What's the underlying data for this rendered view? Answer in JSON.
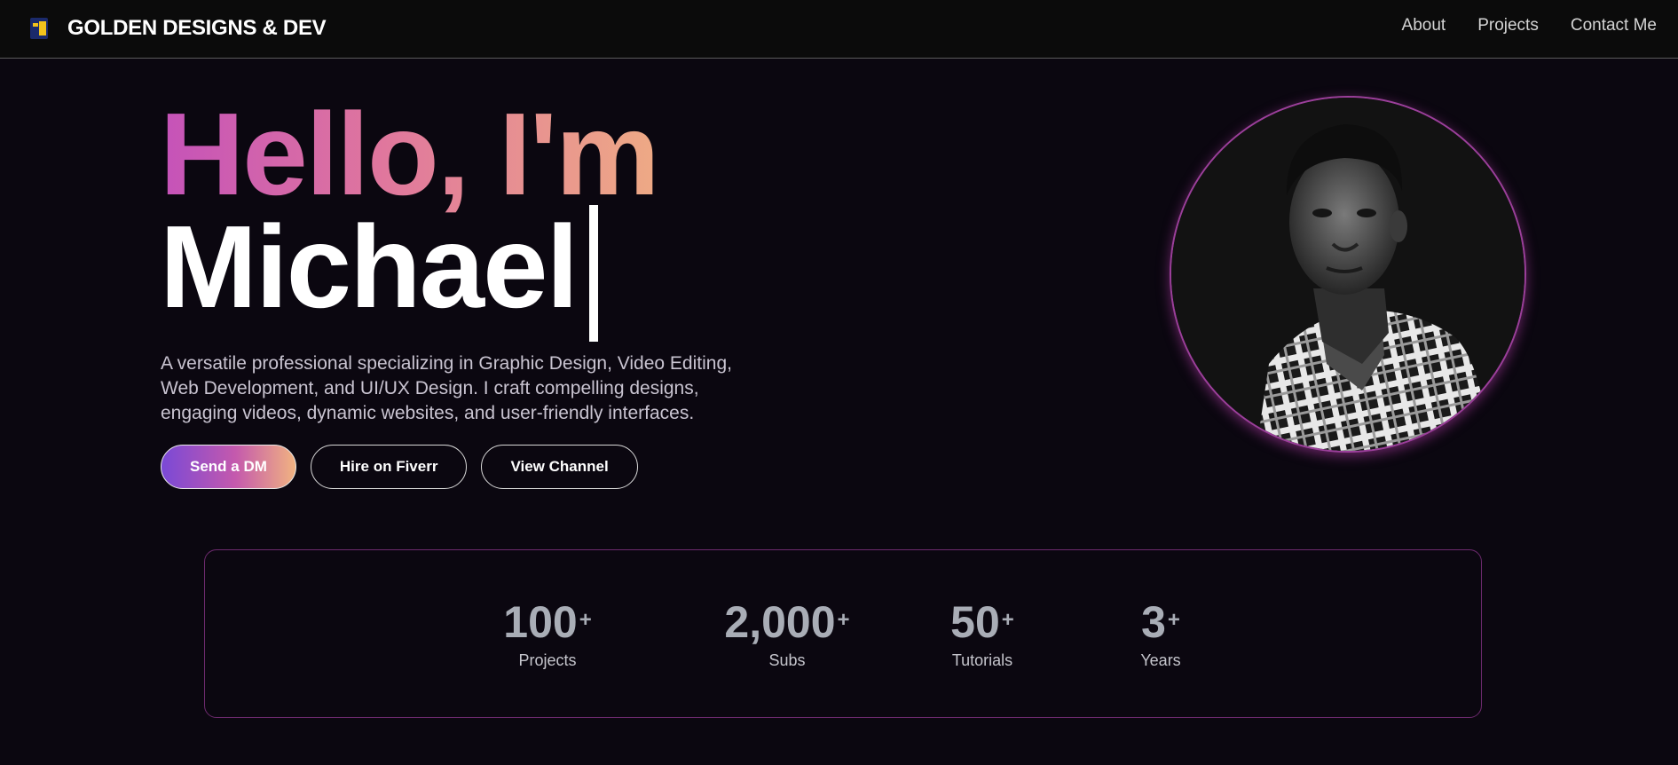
{
  "nav": {
    "brand": "GOLDEN DESIGNS & DEV",
    "links": [
      "About",
      "Projects",
      "Contact Me"
    ]
  },
  "hero": {
    "greeting": "Hello, I'm",
    "name": "Michael",
    "description": "A versatile professional specializing in Graphic Design, Video Editing, Web Development, and UI/UX Design. I craft compelling designs, engaging videos, dynamic websites, and user-friendly interfaces.",
    "buttons": [
      "Send a DM",
      "Hire on Fiverr",
      "View Channel"
    ]
  },
  "stats": [
    {
      "value": "100",
      "suffix": "+",
      "label": "Projects"
    },
    {
      "value": "2,000",
      "suffix": "+",
      "label": "Subs"
    },
    {
      "value": "50",
      "suffix": "+",
      "label": "Tutorials"
    },
    {
      "value": "3",
      "suffix": "+",
      "label": "Years"
    }
  ],
  "colors": {
    "background": "#0b0710",
    "navbar": "#0b0b0b",
    "accent_gradient": [
      "#7a49d6",
      "#c459ad",
      "#f1b381"
    ],
    "title_gradient": [
      "#c552b9",
      "#e0779d",
      "#eeaa85"
    ],
    "stats_border": "#6d2a6e",
    "stat_value": "#a9adb6"
  },
  "icons": {
    "logo": "golden-designs-logo-icon",
    "portrait": "profile-photo"
  }
}
